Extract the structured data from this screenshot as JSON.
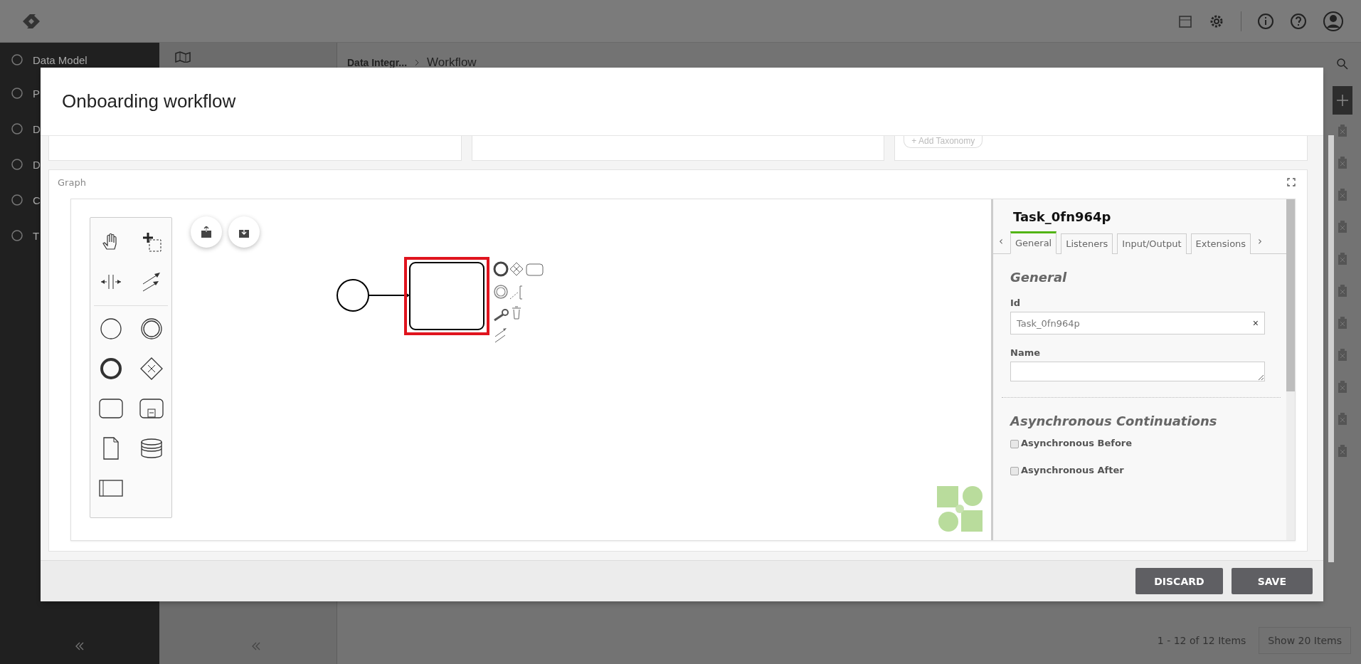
{
  "sidebar": {
    "items": [
      {
        "label": "Data Model"
      },
      {
        "label": "P"
      },
      {
        "label": "D"
      },
      {
        "label": "D"
      },
      {
        "label": "C"
      },
      {
        "label": "T"
      }
    ]
  },
  "breadcrumb": [
    {
      "label": "Data Integr..."
    },
    {
      "label": "Workflow"
    }
  ],
  "pager": {
    "summary": "1 - 12 of 12 Items",
    "page_size": "Show 20 Items"
  },
  "modal": {
    "title": "Onboarding workflow",
    "top_cards": [
      {
        "kind": "blank"
      },
      {
        "kind": "blank"
      },
      {
        "kind": "chip",
        "chip_icon": "+",
        "chip": "Add Taxonomy"
      }
    ],
    "graph": {
      "label": "Graph",
      "properties": {
        "title": "Task_0fn964p",
        "tabs_prev": "‹",
        "tabs_next": "›",
        "clear": "×",
        "tabs": [
          {
            "label": "General",
            "selected": true
          },
          {
            "label": "Listeners",
            "selected": false
          },
          {
            "label": "Input/Output",
            "selected": false
          },
          {
            "label": "Extensions",
            "selected": false
          }
        ],
        "section": "General",
        "id_label": "Id",
        "id_value": "Task_0fn964p",
        "name_label": "Name",
        "async_title": "Asynchronous Continuations",
        "checkboxes": [
          {
            "label": "Asynchronous Before",
            "checked": false
          },
          {
            "label": "Asynchronous After",
            "checked": false
          }
        ]
      }
    },
    "buttons": [
      {
        "label": "DISCARD"
      },
      {
        "label": "SAVE"
      }
    ]
  }
}
